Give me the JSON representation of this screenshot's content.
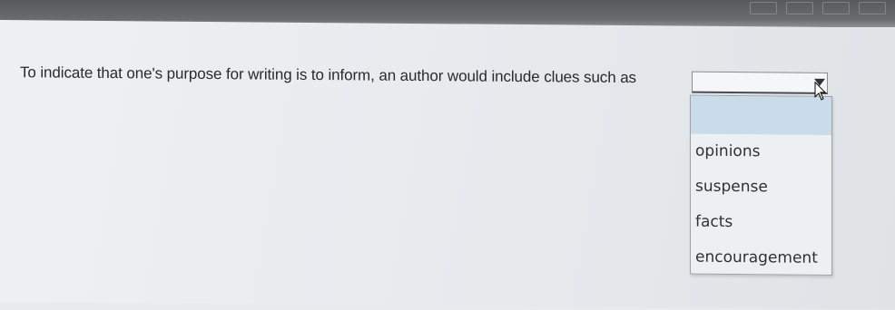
{
  "question": {
    "text": "To indicate that one's purpose for writing is to inform, an author would include clues such as"
  },
  "select": {
    "value": "",
    "options": [
      "opinions",
      "suspense",
      "facts",
      "encouragement"
    ]
  },
  "colors": {
    "highlight": "#c9dcea",
    "bezel": "#58595b"
  }
}
